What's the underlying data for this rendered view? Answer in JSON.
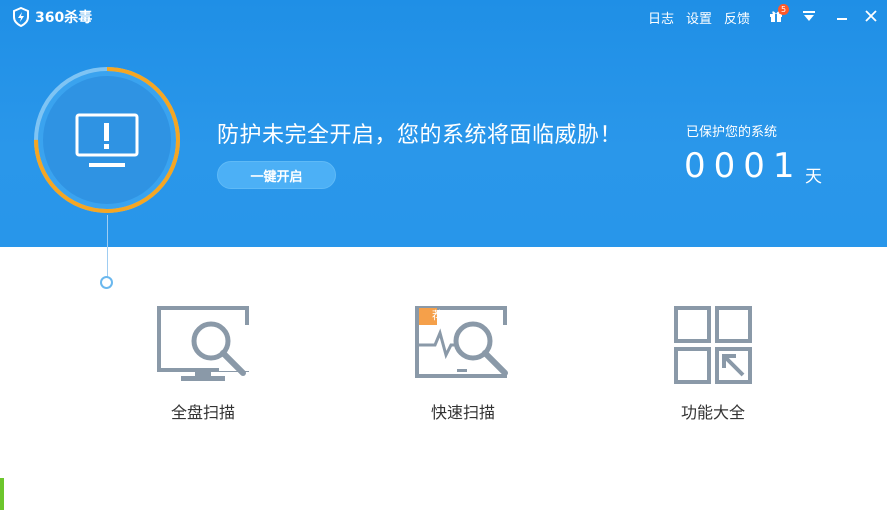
{
  "app": {
    "title": "360杀毒",
    "logo_icon": "shield-bolt-icon"
  },
  "titlebar": {
    "log_label": "日志",
    "settings_label": "设置",
    "feedback_label": "反馈",
    "gift_badge": "5"
  },
  "status": {
    "title": "防护未完全开启，您的系统将面临威胁！",
    "enable_button": "一键开启",
    "protected_label": "已保护您的系统",
    "days_value": "0001",
    "days_unit": "天",
    "progress_percent": 75
  },
  "actions": [
    {
      "label": "全盘扫描",
      "icon": "full-scan-icon"
    },
    {
      "label": "快速扫描",
      "icon": "quick-scan-icon",
      "badge": "荐"
    },
    {
      "label": "功能大全",
      "icon": "feature-grid-icon"
    }
  ],
  "colors": {
    "header_blue": "#2896ea",
    "ring_orange": "#f5a623",
    "icon_gray": "#8a99a8"
  }
}
